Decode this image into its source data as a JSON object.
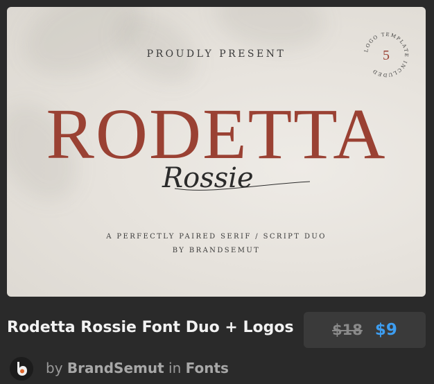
{
  "preview": {
    "proudly_present": "PROUDLY PRESENT",
    "title_main": "RODETTA",
    "title_script": "Rossie",
    "tagline": "A PERFECTLY PAIRED SERIF / SCRIPT DUO",
    "byline": "BY BRANDSEMUT",
    "badge": {
      "number": "5",
      "text": "LOGO TEMPLATE INCLUDED"
    },
    "colors": {
      "background": "#e7e3dd",
      "title": "#9a4133",
      "script": "#2b2b2b"
    }
  },
  "product": {
    "title": "Rodetta Rossie Font Duo + Logos",
    "old_price": "$18",
    "new_price": "$9",
    "price_color": "#3d9df0"
  },
  "author": {
    "by_label": "by",
    "name": "BrandSemut",
    "in_label": "in",
    "category": "Fonts",
    "avatar_icon": "brandsemut-logo-icon"
  }
}
